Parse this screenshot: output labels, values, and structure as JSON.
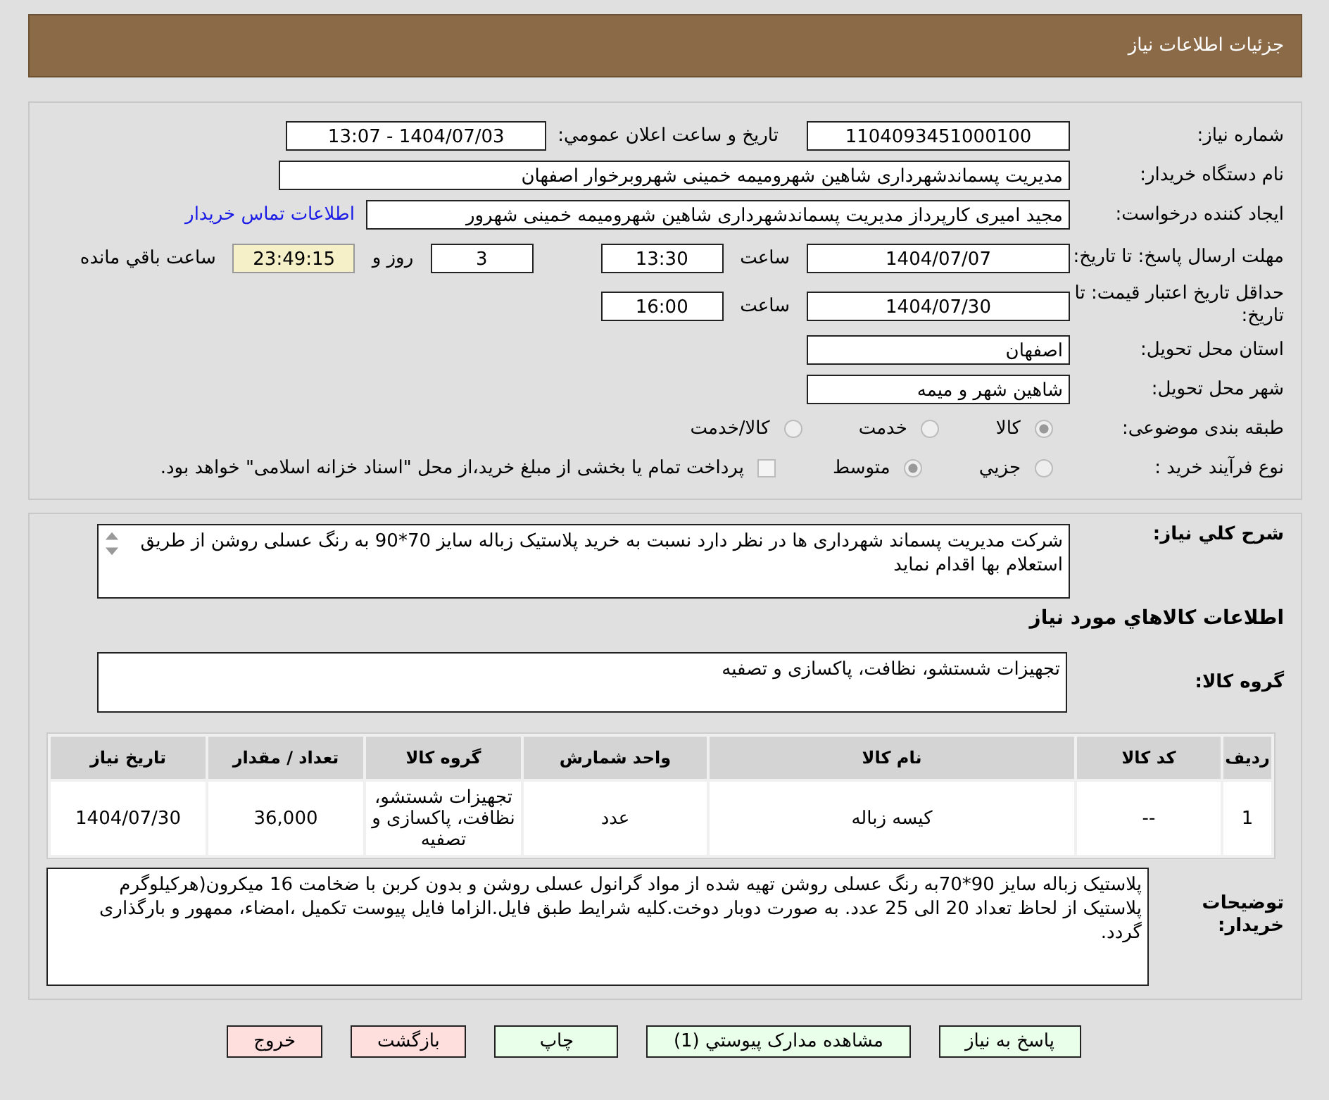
{
  "header": {
    "title": "جزئیات اطلاعات نیاز"
  },
  "form": {
    "need_number": {
      "label": "شماره نیاز:",
      "value": "1104093451000100"
    },
    "announce": {
      "label": "تاريخ و ساعت اعلان عمومي:",
      "value": "1404/07/03 - 13:07"
    },
    "buyer": {
      "label": "نام دستگاه خریدار:",
      "value": "مدیریت پسماندشهرداری شاهین شهرومیمه خمینی شهروبرخوار اصفهان"
    },
    "creator": {
      "label": "ایجاد کننده درخواست:",
      "value": "مجید امیری کارپرداز مدیریت پسماندشهرداری شاهین شهرومیمه خمینی شهرور",
      "link": "اطلاعات تماس خریدار"
    },
    "deadline": {
      "label": "مهلت ارسال پاسخ: تا تاریخ:",
      "date": "1404/07/07",
      "time_label": "ساعت",
      "time": "13:30",
      "days": "3",
      "days_label": "روز و",
      "remaining": "23:49:15",
      "remaining_label": "ساعت باقي مانده"
    },
    "validity": {
      "label": "حداقل تاریخ اعتبار قیمت: تا تاریخ:",
      "date": "1404/07/30",
      "time_label": "ساعت",
      "time": "16:00"
    },
    "province": {
      "label": "استان محل تحویل:",
      "value": "اصفهان"
    },
    "city": {
      "label": "شهر محل تحویل:",
      "value": "شاهین شهر و میمه"
    },
    "category": {
      "label": "طبقه بندی موضوعی:",
      "options": [
        {
          "label": "کالا",
          "selected": true
        },
        {
          "label": "خدمت",
          "selected": false
        },
        {
          "label": "کالا/خدمت",
          "selected": false
        }
      ]
    },
    "process": {
      "label": "نوع فرآیند خرید :",
      "options": [
        {
          "label": "جزيي",
          "selected": false
        },
        {
          "label": "متوسط",
          "selected": true
        }
      ],
      "payment": {
        "label": "پرداخت تمام یا بخشی از مبلغ خرید،از محل \"اسناد خزانه اسلامی\" خواهد بود.",
        "checked": false
      }
    }
  },
  "details": {
    "summary": {
      "label": "شرح کلي نياز:",
      "value": "شرکت مدیریت پسماند شهرداری ها در نظر دارد نسبت به خرید پلاستیک زباله سایز 70*90 به رنگ عسلی روشن از طریق استعلام بها اقدام نماید"
    },
    "goods_heading": "اطلاعات کالاهاي مورد نياز",
    "group": {
      "label": "گروه کالا:",
      "value": "تجهیزات شستشو، نظافت، پاکسازی و تصفیه"
    },
    "table": {
      "columns": [
        "رديف",
        "کد کالا",
        "نام کالا",
        "واحد شمارش",
        "گروه کالا",
        "تعداد / مقدار",
        "تاريخ نياز"
      ],
      "rows": [
        [
          "1",
          "--",
          "کیسه زباله",
          "عدد",
          "تجهیزات شستشو، نظافت، پاکسازی و تصفیه",
          "36,000",
          "1404/07/30"
        ]
      ]
    },
    "notes": {
      "label": "توضیحات خریدار:",
      "value": "پلاستیک زباله سایز 90*70به رنگ عسلی روشن تهیه شده از مواد گرانول عسلی روشن و بدون کربن با ضخامت 16 میکرون(هرکیلوگرم پلاستیک از لحاظ تعداد 20 الی 25 عدد. به صورت دوبار دوخت.کلیه شرایط طبق فایل.الزاما فایل پیوست تکمیل ،امضاء، ممهور و بارگذاری گردد."
    }
  },
  "buttons": [
    {
      "label": "پاسخ به نیاز",
      "kind": "primary"
    },
    {
      "label": "مشاهده مدارک پیوستي (1)",
      "kind": "primary"
    },
    {
      "label": "چاپ",
      "kind": "primary"
    },
    {
      "label": "بازگشت",
      "kind": "danger"
    },
    {
      "label": "خروج",
      "kind": "danger"
    }
  ]
}
